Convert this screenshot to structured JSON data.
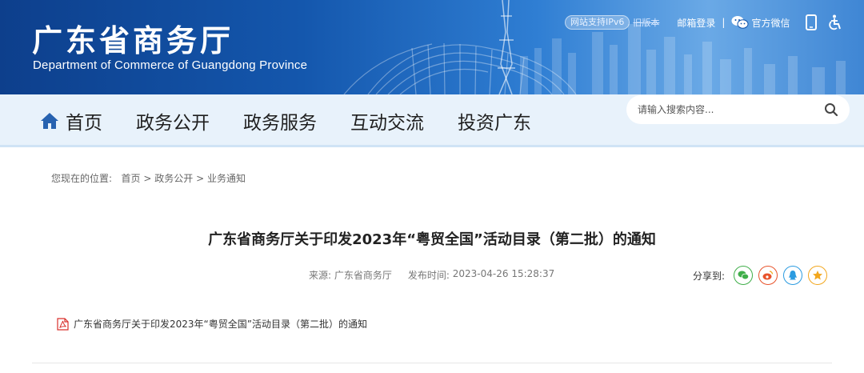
{
  "header": {
    "title": "广东省商务厅",
    "subtitle": "Department of Commerce of Guangdong Province",
    "ipv6": "网站支持IPv6",
    "old_version": "旧版本",
    "mail_login": "邮箱登录",
    "separator": "|",
    "wechat": "官方微信",
    "icons": [
      "wechat-icon",
      "mobile-icon",
      "accessibility-icon"
    ]
  },
  "nav": {
    "items": [
      {
        "label": "首页",
        "icon": "home-icon"
      },
      {
        "label": "政务公开"
      },
      {
        "label": "政务服务"
      },
      {
        "label": "互动交流"
      },
      {
        "label": "投资广东"
      }
    ],
    "search": {
      "placeholder": "请输入搜索内容...",
      "value": ""
    }
  },
  "breadcrumb": {
    "prefix": "您现在的位置:",
    "items": [
      "首页",
      "政务公开",
      "业务通知"
    ],
    "separator": ">"
  },
  "article": {
    "title": "广东省商务厅关于印发2023年“粤贸全国”活动目录（第二批）的通知",
    "source_label": "来源:",
    "source": "广东省商务厅",
    "time_label": "发布时间:",
    "time": "2023-04-26 15:28:37",
    "share_label": "分享到:",
    "share_targets": [
      {
        "name": "wechat",
        "color": "#3fae49"
      },
      {
        "name": "weibo",
        "color": "#e8532b"
      },
      {
        "name": "qq",
        "color": "#2b9be0"
      },
      {
        "name": "qzone",
        "color": "#f2a71e"
      }
    ],
    "attachment": "广东省商务厅关于印发2023年“粤贸全国”活动目录（第二批）的通知"
  },
  "colors": {
    "banner": "#1457ad",
    "nav_bg": "#e8f2fb",
    "home_icon": "#2762b0",
    "pdf_red": "#d9302c"
  }
}
